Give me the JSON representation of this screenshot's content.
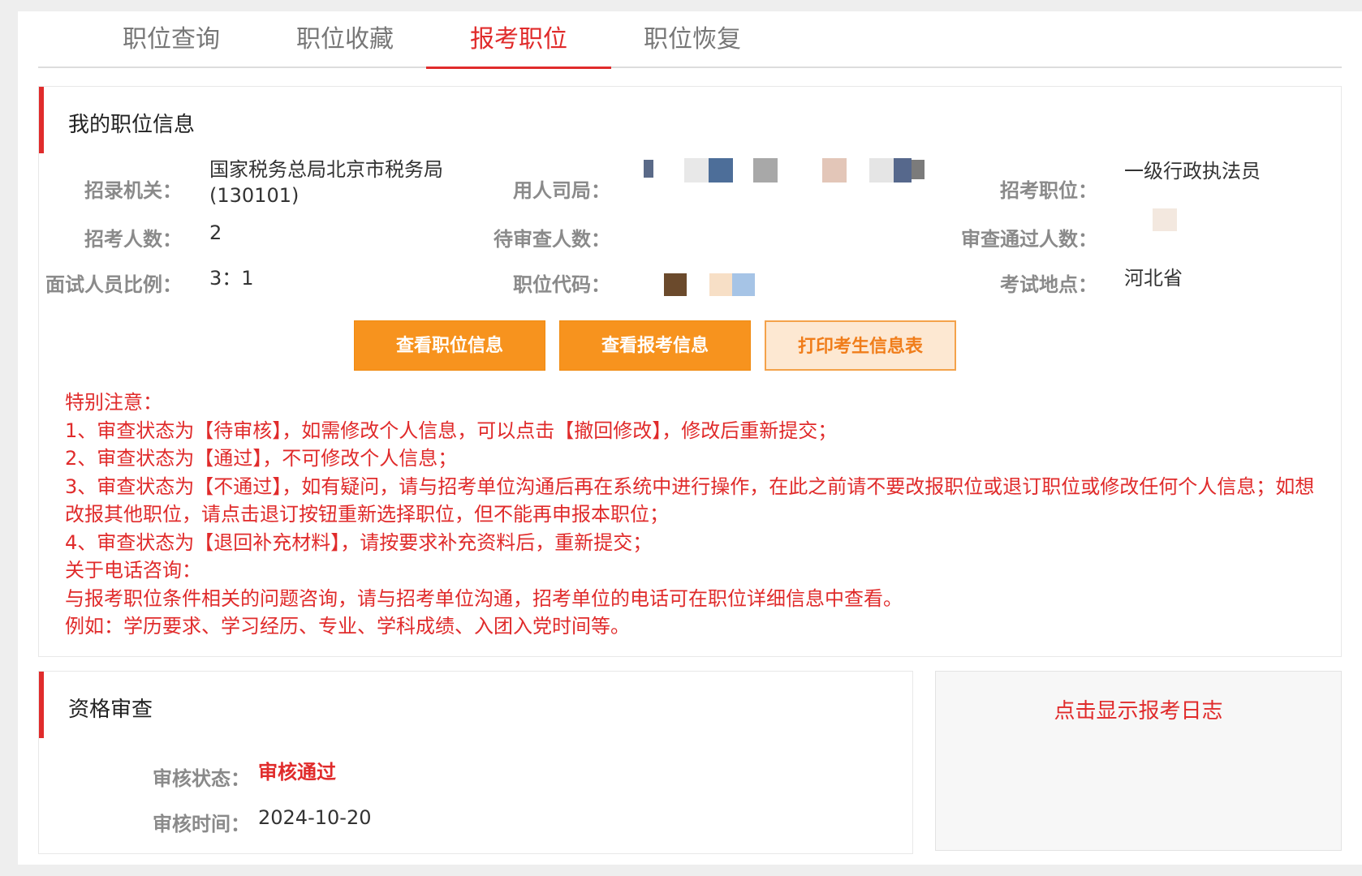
{
  "tabs": [
    {
      "label": "职位查询",
      "active": false
    },
    {
      "label": "职位收藏",
      "active": false
    },
    {
      "label": "报考职位",
      "active": true
    },
    {
      "label": "职位恢复",
      "active": false
    }
  ],
  "position_info": {
    "title": "我的职位信息",
    "fields": {
      "agency_label": "招录机关：",
      "agency_value_line1": "国家税务总局北京市税务局",
      "agency_value_line2": "(130101)",
      "department_label": "用人司局：",
      "position_label": "招考职位：",
      "position_value": "一级行政执法员",
      "recruit_count_label": "招考人数：",
      "recruit_count_value": "2",
      "pending_review_label": "待审查人数：",
      "passed_review_label": "审查通过人数：",
      "interview_ratio_label": "面试人员比例：",
      "interview_ratio_value": "3：1",
      "position_code_label": "职位代码：",
      "exam_location_label": "考试地点：",
      "exam_location_value": "河北省"
    },
    "buttons": {
      "view_position": "查看职位信息",
      "view_application": "查看报考信息",
      "print_form": "打印考生信息表"
    },
    "notice": [
      "特别注意：",
      "1、审查状态为【待审核】，如需修改个人信息，可以点击【撤回修改】，修改后重新提交；",
      "2、审查状态为【通过】，不可修改个人信息；",
      "3、审查状态为【不通过】，如有疑问，请与招考单位沟通后再在系统中进行操作，在此之前请不要改报职位或退订职位或修改任何个人信息；如想改报其他职位，请点击退订按钮重新选择职位，但不能再申报本职位；",
      "4、审查状态为【退回补充材料】，请按要求补充资料后，重新提交；",
      "关于电话咨询：",
      "与报考职位条件相关的问题咨询，请与招考单位沟通，招考单位的电话可在职位详细信息中查看。",
      "例如：学历要求、学习经历、专业、学科成绩、入团入党时间等。"
    ]
  },
  "qualification_review": {
    "title": "资格审查",
    "status_label": "审核状态：",
    "status_value": "审核通过",
    "time_label": "审核时间：",
    "time_value": "2024-10-20"
  },
  "log_panel": {
    "link_text": "点击显示报考日志"
  },
  "colors": {
    "accent_red": "#e02b2b",
    "button_orange": "#f7931e",
    "button_outline_bg": "#fde8d2"
  }
}
